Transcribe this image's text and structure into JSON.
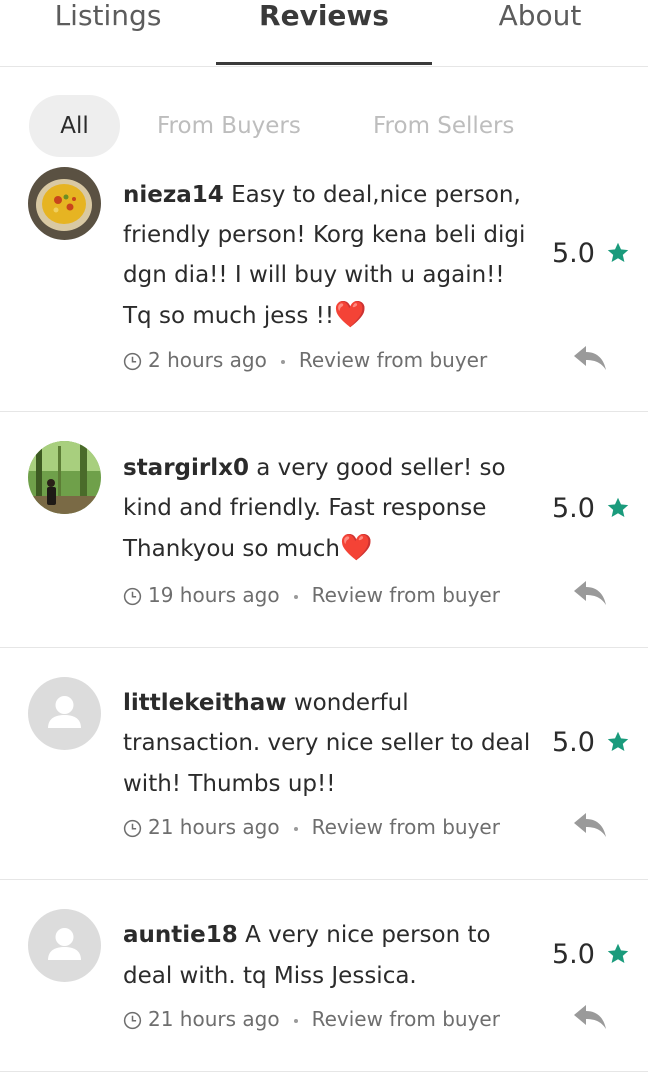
{
  "tabs": [
    {
      "label": "Listings",
      "active": false
    },
    {
      "label": "Reviews",
      "active": true
    },
    {
      "label": "About",
      "active": false
    }
  ],
  "filters": {
    "all": "All",
    "buyers": "From Buyers",
    "sellers": "From Sellers",
    "selected": "All"
  },
  "colors": {
    "star": "#1a9b7c",
    "heart": "#e0282e",
    "active_tab": "#3a3a3a",
    "inactive_filter": "#bdbdbd"
  },
  "reviews": [
    {
      "username": "nieza14",
      "text": "Easy to deal,nice person, friendly person! Korg kena beli digi dgn dia!! I will buy with u again!! Tq so much jess !!",
      "emoji": "❤️",
      "time": "2 hours ago",
      "source": "Review from buyer",
      "rating": "5.0",
      "avatar": "food-photo"
    },
    {
      "username": "stargirlx0",
      "text": "a very good seller! so kind and friendly. Fast response Thankyou so much",
      "emoji": "❤️",
      "time": "19 hours ago",
      "source": "Review from buyer",
      "rating": "5.0",
      "avatar": "forest-photo"
    },
    {
      "username": "littlekeithaw",
      "text": "wonderful transaction. very nice seller to deal with! Thumbs up!!",
      "emoji": "",
      "time": "21 hours ago",
      "source": "Review from buyer",
      "rating": "5.0",
      "avatar": "default-user-icon"
    },
    {
      "username": "auntie18",
      "text": "A very nice person to deal with.  tq Miss Jessica.",
      "emoji": "",
      "time": "21 hours ago",
      "source": "Review from buyer",
      "rating": "5.0",
      "avatar": "default-user-icon"
    }
  ]
}
